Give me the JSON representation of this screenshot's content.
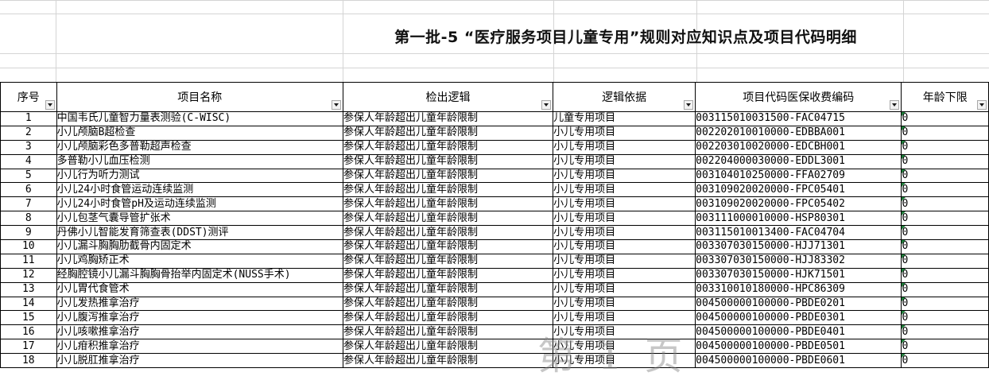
{
  "title": "第一批-5 “医疗服务项目儿童专用”规则对应知识点及项目代码明细",
  "columns": [
    "序号",
    "项目名称",
    "检出逻辑",
    "逻辑依据",
    "项目代码医保收费编码",
    "年龄下限"
  ],
  "rows": [
    {
      "seq": "1",
      "name": "中国韦氏儿童智力量表测验(C-WISC)",
      "logic": "参保人年龄超出儿童年龄限制",
      "basis": "儿童专用项目",
      "code": "003115010031500-FAC04715",
      "age": "0"
    },
    {
      "seq": "2",
      "name": "小儿颅脑B超检查",
      "logic": "参保人年龄超出儿童年龄限制",
      "basis": "小儿专用项目",
      "code": "002202010010000-EDBBA001",
      "age": "0"
    },
    {
      "seq": "3",
      "name": "小儿颅脑彩色多普勒超声检查",
      "logic": "参保人年龄超出儿童年龄限制",
      "basis": "小儿专用项目",
      "code": "002203010020000-EDCBH001",
      "age": "0"
    },
    {
      "seq": "4",
      "name": "多普勒小儿血压检测",
      "logic": "参保人年龄超出儿童年龄限制",
      "basis": "小儿专用项目",
      "code": "002204000030000-EDDL3001",
      "age": "0"
    },
    {
      "seq": "5",
      "name": "小儿行为听力测试",
      "logic": "参保人年龄超出儿童年龄限制",
      "basis": "小儿专用项目",
      "code": "003104010250000-FFA02709",
      "age": "0"
    },
    {
      "seq": "6",
      "name": "小儿24小时食管运动连续监测",
      "logic": "参保人年龄超出儿童年龄限制",
      "basis": "小儿专用项目",
      "code": "003109020020000-FPC05401",
      "age": "0"
    },
    {
      "seq": "7",
      "name": "小儿24小时食管pH及运动连续监测",
      "logic": "参保人年龄超出儿童年龄限制",
      "basis": "小儿专用项目",
      "code": "003109020020000-FPC05402",
      "age": "0"
    },
    {
      "seq": "8",
      "name": "小儿包茎气囊导管扩张术",
      "logic": "参保人年龄超出儿童年龄限制",
      "basis": "小儿专用项目",
      "code": "003111000010000-HSP80301",
      "age": "0"
    },
    {
      "seq": "9",
      "name": "丹佛小儿智能发育筛查表(DDST)测评",
      "logic": "参保人年龄超出儿童年龄限制",
      "basis": "小儿专用项目",
      "code": "003115010013400-FAC04704",
      "age": "0"
    },
    {
      "seq": "10",
      "name": "小儿漏斗胸胸肋截骨内固定术",
      "logic": "参保人年龄超出儿童年龄限制",
      "basis": "小儿专用项目",
      "code": "003307030150000-HJJ71301",
      "age": "0"
    },
    {
      "seq": "11",
      "name": "小儿鸡胸矫正术",
      "logic": "参保人年龄超出儿童年龄限制",
      "basis": "小儿专用项目",
      "code": "003307030150000-HJJ83302",
      "age": "0"
    },
    {
      "seq": "12",
      "name": "经胸腔镜小儿漏斗胸胸骨抬举内固定术(NUSS手术)",
      "logic": "参保人年龄超出儿童年龄限制",
      "basis": "小儿专用项目",
      "code": "003307030150000-HJK71501",
      "age": "0"
    },
    {
      "seq": "13",
      "name": "小儿胃代食管术",
      "logic": "参保人年龄超出儿童年龄限制",
      "basis": "小儿专用项目",
      "code": "003310010180000-HPC86309",
      "age": "0"
    },
    {
      "seq": "14",
      "name": "小儿发热推拿治疗",
      "logic": "参保人年龄超出儿童年龄限制",
      "basis": "小儿专用项目",
      "code": "004500000100000-PBDE0201",
      "age": "0"
    },
    {
      "seq": "15",
      "name": "小儿腹泻推拿治疗",
      "logic": "参保人年龄超出儿童年龄限制",
      "basis": "小儿专用项目",
      "code": "004500000100000-PBDE0301",
      "age": "0"
    },
    {
      "seq": "16",
      "name": "小儿咳嗽推拿治疗",
      "logic": "参保人年龄超出儿童年龄限制",
      "basis": "小儿专用项目",
      "code": "004500000100000-PBDE0401",
      "age": "0"
    },
    {
      "seq": "17",
      "name": "小儿疳积推拿治疗",
      "logic": "参保人年龄超出儿童年龄限制",
      "basis": "小儿专用项目",
      "code": "004500000100000-PBDE0501",
      "age": "0"
    },
    {
      "seq": "18",
      "name": "小儿脱肛推拿治疗",
      "logic": "参保人年龄超出儿童年龄限制",
      "basis": "小儿专用项目",
      "code": "004500000100000-PBDE0601",
      "age": "0"
    }
  ],
  "watermark": "第1页",
  "colors": {
    "grid_border": "#000000",
    "gridline": "#d4d4d4",
    "comment_marker": "#1e7f3a"
  }
}
